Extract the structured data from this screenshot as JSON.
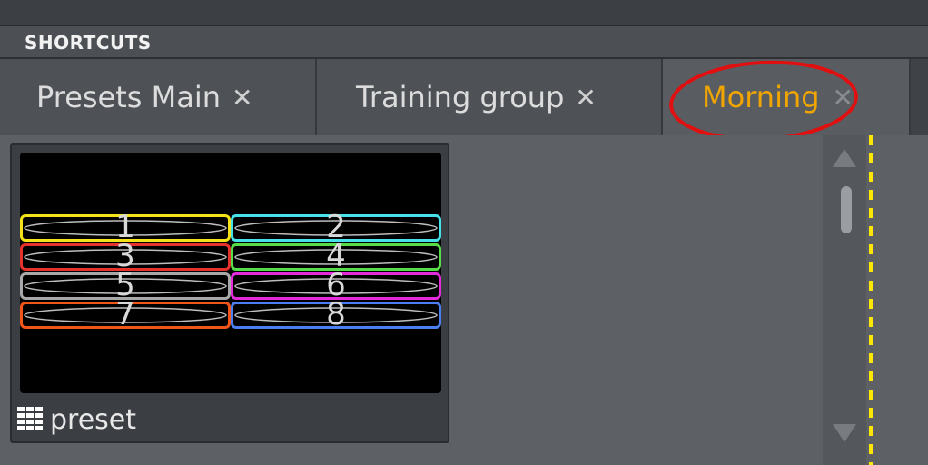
{
  "panel": {
    "title": "SHORTCUTS"
  },
  "tabs": [
    {
      "label": "Presets Main",
      "close": "✕",
      "active": false
    },
    {
      "label": "Training group",
      "close": "✕",
      "active": false
    },
    {
      "label": "Morning",
      "close": "✕",
      "active": true
    }
  ],
  "preset_card": {
    "label": "preset",
    "icon": "grid-icon",
    "slots": [
      {
        "number": "1",
        "color": "#f3e21a"
      },
      {
        "number": "2",
        "color": "#47e1e9"
      },
      {
        "number": "3",
        "color": "#e5322d"
      },
      {
        "number": "4",
        "color": "#58dd4a"
      },
      {
        "number": "5",
        "color": "#a8a8a8"
      },
      {
        "number": "6",
        "color": "#e32bdc"
      },
      {
        "number": "7",
        "color": "#f0561a"
      },
      {
        "number": "8",
        "color": "#4b7ef0"
      }
    ]
  },
  "colors": {
    "active_tab": "#f0a500",
    "annotation": "#e01010",
    "guide_line": "#ffe800"
  }
}
